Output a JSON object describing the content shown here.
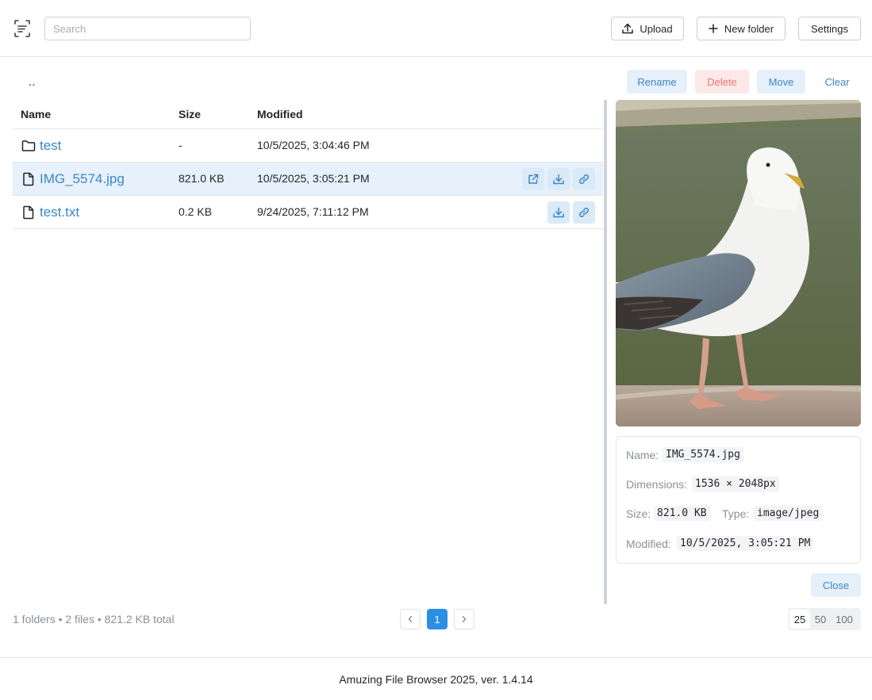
{
  "header": {
    "search_placeholder": "Search",
    "upload_label": "Upload",
    "new_folder_label": "New folder",
    "settings_label": "Settings"
  },
  "toolbar": {
    "up_link": "..",
    "rename_label": "Rename",
    "delete_label": "Delete",
    "move_label": "Move",
    "clear_label": "Clear"
  },
  "table": {
    "columns": [
      "Name",
      "Size",
      "Modified"
    ],
    "rows": [
      {
        "type": "folder",
        "name": "test",
        "size": "-",
        "modified": "10/5/2025, 3:04:46 PM",
        "selected": false
      },
      {
        "type": "file",
        "name": "IMG_5574.jpg",
        "size": "821.0 KB",
        "modified": "10/5/2025, 3:05:21 PM",
        "selected": true,
        "actions": [
          "open-external-icon",
          "download-icon",
          "link-icon"
        ]
      },
      {
        "type": "file",
        "name": "test.txt",
        "size": "0.2 KB",
        "modified": "9/24/2025, 7:11:12 PM",
        "selected": false,
        "actions": [
          "download-icon",
          "link-icon"
        ]
      }
    ]
  },
  "details": {
    "name_label": "Name:",
    "name_value": "IMG_5574.jpg",
    "dimensions_label": "Dimensions:",
    "dimensions_value": "1536 × 2048px",
    "size_label": "Size:",
    "size_value": "821.0 KB",
    "type_label": "Type:",
    "type_value": "image/jpeg",
    "modified_label": "Modified:",
    "modified_value": "10/5/2025, 3:05:21 PM",
    "close_label": "Close"
  },
  "status": {
    "summary": "1 folders • 2 files • 821.2 KB total",
    "current_page": "1",
    "page_sizes": [
      "25",
      "50",
      "100"
    ],
    "selected_page_size": "25"
  },
  "footer": {
    "text": "Amuzing File Browser 2025, ver. 1.4.14"
  },
  "colors": {
    "accent": "#3b86c8",
    "selected_row": "#e7f1fb",
    "danger": "#ef7676"
  }
}
